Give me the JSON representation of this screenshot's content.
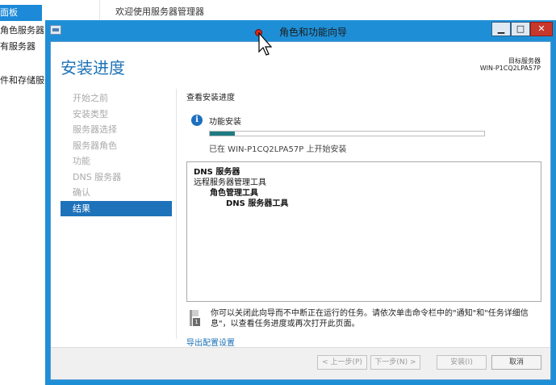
{
  "background": {
    "nav_items": [
      "面板",
      "角色服务器",
      "有服务器",
      "件和存储服务"
    ],
    "header_text": "欢迎使用服务器管理器"
  },
  "window": {
    "title": "角色和功能向导",
    "controls": {
      "minimize": "▁",
      "maximize": "□",
      "close": "✕"
    },
    "page_title": "安装进度",
    "target_label": "目标服务器",
    "target_name": "WIN-P1CQ2LPA57P",
    "steps": [
      {
        "label": "开始之前",
        "active": false
      },
      {
        "label": "安装类型",
        "active": false
      },
      {
        "label": "服务器选择",
        "active": false
      },
      {
        "label": "服务器角色",
        "active": false
      },
      {
        "label": "功能",
        "active": false
      },
      {
        "label": "DNS 服务器",
        "active": false
      },
      {
        "label": "确认",
        "active": false
      },
      {
        "label": "结果",
        "active": true
      }
    ],
    "section_title": "查看安装进度",
    "info_label": "功能安装",
    "progress": 0.09,
    "progress_status": "已在 WIN-P1CQ2LPA57P 上开始安装",
    "results": [
      {
        "text": "DNS 服务器",
        "level": 1
      },
      {
        "text": "远程服务器管理工具",
        "level": 2
      },
      {
        "text": "角色管理工具",
        "level": 3
      },
      {
        "text": "DNS 服务器工具",
        "level": 4
      }
    ],
    "note": "你可以关闭此向导而不中断正在运行的任务。请依次单击命令栏中的\"通知\"和\"任务详细信息\"，以查看任务进度或再次打开此页面。",
    "export_link": "导出配置设置",
    "buttons": {
      "prev": "< 上一步(P)",
      "next": "下一步(N) >",
      "install": "安装(I)",
      "cancel": "取消"
    }
  }
}
